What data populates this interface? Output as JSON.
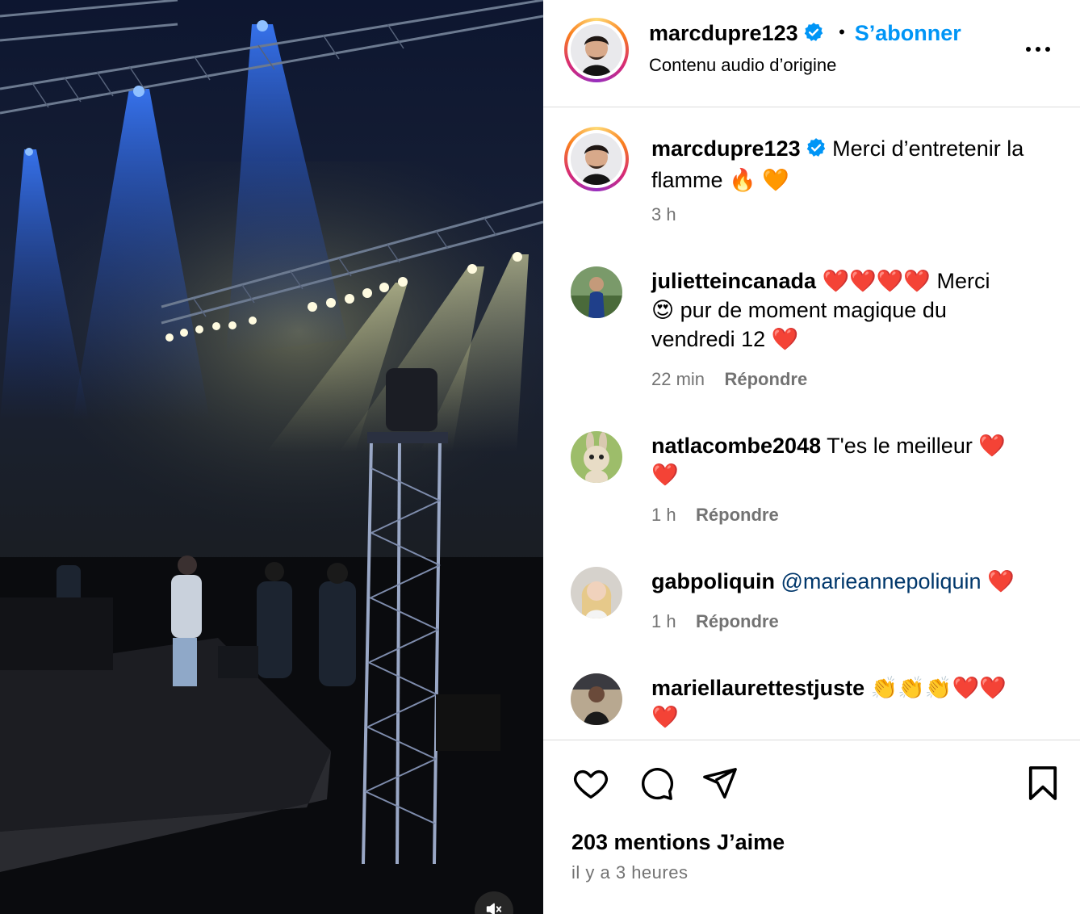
{
  "post": {
    "author": "marcdupre123",
    "follow_label": "S’abonner",
    "audio_label": "Contenu audio d’origine",
    "caption": "Merci d’entretenir la flamme 🔥 🧡",
    "caption_time": "3 h",
    "likes": "203 mentions J’aime",
    "posted": "il y a 3 heures"
  },
  "comments": [
    {
      "user": "julietteincanada",
      "text_1": "❤️❤️❤️❤️ Merci",
      "text_2": "😍 pur de moment magique du",
      "text_3": "vendredi 12 ❤️",
      "time": "22 min",
      "reply": "Répondre"
    },
    {
      "user": "natlacombe2048",
      "text_1": "T'es le meilleur ❤️",
      "text_2": "❤️",
      "time": "1 h",
      "reply": "Répondre"
    },
    {
      "user": "gabpoliquin",
      "mention": "@marieannepoliquin",
      "text_1": "❤️",
      "time": "1 h",
      "reply": "Répondre"
    },
    {
      "user": "mariellaurettestjuste",
      "text_1": "👏👏👏❤️❤️",
      "text_2": "❤️"
    }
  ],
  "colors": {
    "accent": "#0095f6",
    "verified": "#0095f6",
    "muted": "#737373",
    "mention": "#00376b"
  },
  "icons": [
    "more-icon",
    "verified-icon",
    "heart-icon",
    "comment-icon",
    "share-icon",
    "bookmark-icon",
    "mute-icon"
  ]
}
